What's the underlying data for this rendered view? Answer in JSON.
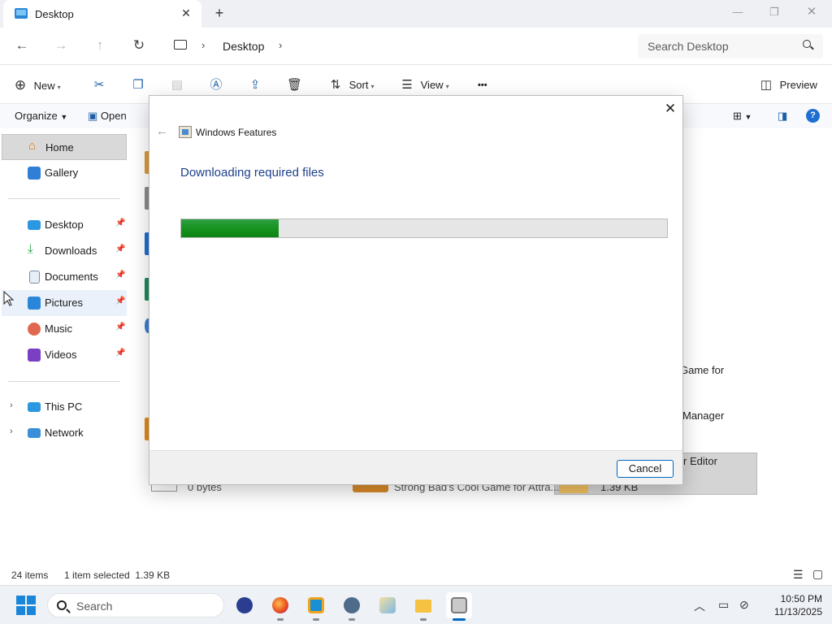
{
  "explorer": {
    "tab_title": "Desktop",
    "breadcrumb": [
      "Desktop"
    ],
    "search_placeholder": "Search Desktop",
    "commands": {
      "new": "New",
      "sort": "Sort",
      "view": "View",
      "preview": "Preview",
      "more": "•••"
    },
    "ribbon2": {
      "organize": "Organize",
      "open": "Open"
    },
    "sidebar": {
      "items": [
        {
          "label": "Home",
          "icon": "home-icon"
        },
        {
          "label": "Gallery",
          "icon": "gallery-icon"
        },
        {
          "label": "Desktop",
          "icon": "desktop-icon",
          "pinned": true
        },
        {
          "label": "Downloads",
          "icon": "downloads-icon",
          "pinned": true
        },
        {
          "label": "Documents",
          "icon": "documents-icon",
          "pinned": true
        },
        {
          "label": "Pictures",
          "icon": "pictures-icon",
          "pinned": true
        },
        {
          "label": "Music",
          "icon": "music-icon",
          "pinned": true
        },
        {
          "label": "Videos",
          "icon": "videos-icon",
          "pinned": true
        },
        {
          "label": "This PC",
          "icon": "this-pc-icon"
        },
        {
          "label": "Network",
          "icon": "network-icon"
        }
      ]
    },
    "content_fragments": {
      "frag1": "Game for",
      "frag2": "Manager",
      "frag3": "r Editor",
      "frag4": "0 bytes",
      "frag5": "Strong Bad's Cool Game for Attra...",
      "frag6": "1.39 KB"
    },
    "status": {
      "items_count": "24 items",
      "selection": "1 item selected  1.39 KB"
    }
  },
  "dialog": {
    "title": "Windows Features",
    "heading": "Downloading required files",
    "progress_fraction": 0.2,
    "cancel_label": "Cancel"
  },
  "taskbar": {
    "search_placeholder": "Search",
    "time": "10:50 PM",
    "date": "11/13/2025"
  },
  "colors": {
    "accent": "#0067c0",
    "heading_blue": "#1e3f8a",
    "progress_green": "#17931e"
  }
}
